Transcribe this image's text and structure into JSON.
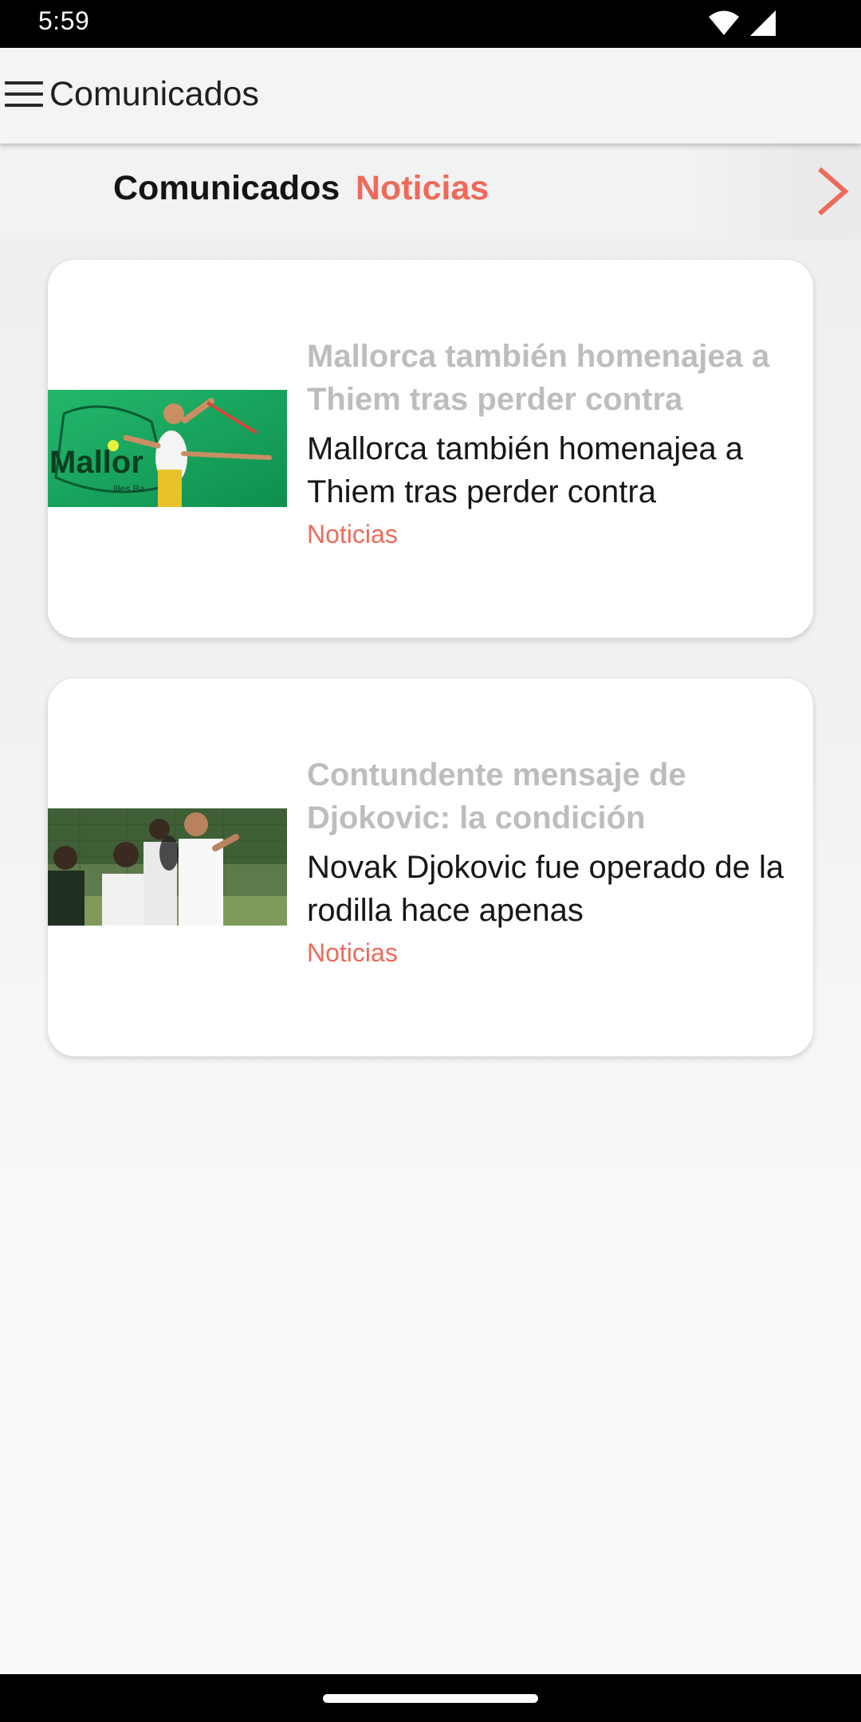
{
  "status_bar": {
    "time": "5:59",
    "icons": [
      "wifi-icon",
      "cell-signal-icon"
    ]
  },
  "app_bar": {
    "menu_icon": "hamburger-menu-icon",
    "title": "Comunicados"
  },
  "tabs": [
    {
      "label": "Comunicados",
      "selected": false
    },
    {
      "label": "Noticias",
      "selected": true
    }
  ],
  "tabs_scroll_icon": "chevron-right-icon",
  "colors": {
    "accent": "#ee6a5a",
    "title_muted": "#bdbdbd",
    "text": "#161616",
    "card_bg": "#ffffff",
    "page_bg": "#f0f0f0"
  },
  "cards": [
    {
      "title": "Mallorca también homenajea a Thiem tras perder contra",
      "summary": "Mallorca también homenajea a Thiem tras perder contra",
      "category": "Noticias",
      "image": "tennis-player-mallorca-photo"
    },
    {
      "title": "Contundente mensaje de Djokovic: la condición",
      "summary": "Novak Djokovic fue operado de la rodilla hace apenas",
      "category": "Noticias",
      "image": "djokovic-training-photo"
    }
  ]
}
